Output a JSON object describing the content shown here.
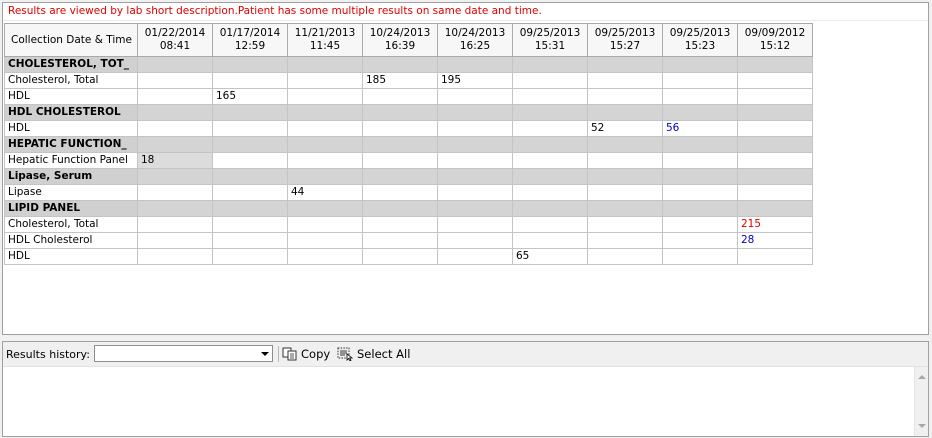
{
  "notice": "Results are viewed by lab short description.Patient has some multiple results on same date and time.",
  "grid": {
    "first_header": "Collection Date & Time",
    "columns": [
      {
        "date": "01/22/2014",
        "time": "08:41"
      },
      {
        "date": "01/17/2014",
        "time": "12:59"
      },
      {
        "date": "11/21/2013",
        "time": "11:45"
      },
      {
        "date": "10/24/2013",
        "time": "16:39"
      },
      {
        "date": "10/24/2013",
        "time": "16:25"
      },
      {
        "date": "09/25/2013",
        "time": "15:31"
      },
      {
        "date": "09/25/2013",
        "time": "15:27"
      },
      {
        "date": "09/25/2013",
        "time": "15:23"
      },
      {
        "date": "09/09/2012",
        "time": "15:12"
      }
    ],
    "rows": [
      {
        "type": "group",
        "label": "CHOLESTEROL, TOT_"
      },
      {
        "type": "data",
        "label": "Cholesterol, Total",
        "values": [
          "",
          "",
          "",
          "185",
          "195",
          "",
          "",
          "",
          ""
        ]
      },
      {
        "type": "data",
        "label": "HDL",
        "values": [
          "",
          "165",
          "",
          "",
          "",
          "",
          "",
          "",
          ""
        ]
      },
      {
        "type": "group",
        "label": "HDL CHOLESTEROL"
      },
      {
        "type": "data",
        "label": "HDL",
        "values": [
          "",
          "",
          "",
          "",
          "",
          "",
          "52",
          "56",
          ""
        ],
        "colors": [
          "",
          "",
          "",
          "",
          "",
          "",
          "",
          "#0000cc",
          ""
        ]
      },
      {
        "type": "group",
        "label": "HEPATIC FUNCTION_"
      },
      {
        "type": "data",
        "label": "Hepatic Function Panel",
        "values": [
          "18",
          "",
          "",
          "",
          "",
          "",
          "",
          "",
          ""
        ],
        "shaded": [
          0
        ]
      },
      {
        "type": "group",
        "label": "Lipase, Serum"
      },
      {
        "type": "data",
        "label": "Lipase",
        "values": [
          "",
          "",
          "44",
          "",
          "",
          "",
          "",
          "",
          ""
        ]
      },
      {
        "type": "group",
        "label": "LIPID PANEL"
      },
      {
        "type": "data",
        "label": "Cholesterol, Total",
        "values": [
          "",
          "",
          "",
          "",
          "",
          "",
          "",
          "",
          "215"
        ],
        "colors": [
          "",
          "",
          "",
          "",
          "",
          "",
          "",
          "",
          "#e00000"
        ]
      },
      {
        "type": "data",
        "label": "HDL Cholesterol",
        "values": [
          "",
          "",
          "",
          "",
          "",
          "",
          "",
          "",
          "28"
        ],
        "colors": [
          "",
          "",
          "",
          "",
          "",
          "",
          "",
          "",
          "#0000cc"
        ]
      },
      {
        "type": "data",
        "label": "HDL",
        "values": [
          "",
          "",
          "",
          "",
          "",
          "65",
          "",
          "",
          ""
        ]
      }
    ]
  },
  "history": {
    "label": "Results history:",
    "selected": "",
    "copy_label": "Copy",
    "select_all_label": "Select All",
    "copy_icon": "copy-icon",
    "select_all_icon": "select-all-icon"
  },
  "colors": {
    "notice": "#e00000",
    "low": "#0000cc",
    "high": "#e00000",
    "group_bg": "#d4d4d4"
  }
}
